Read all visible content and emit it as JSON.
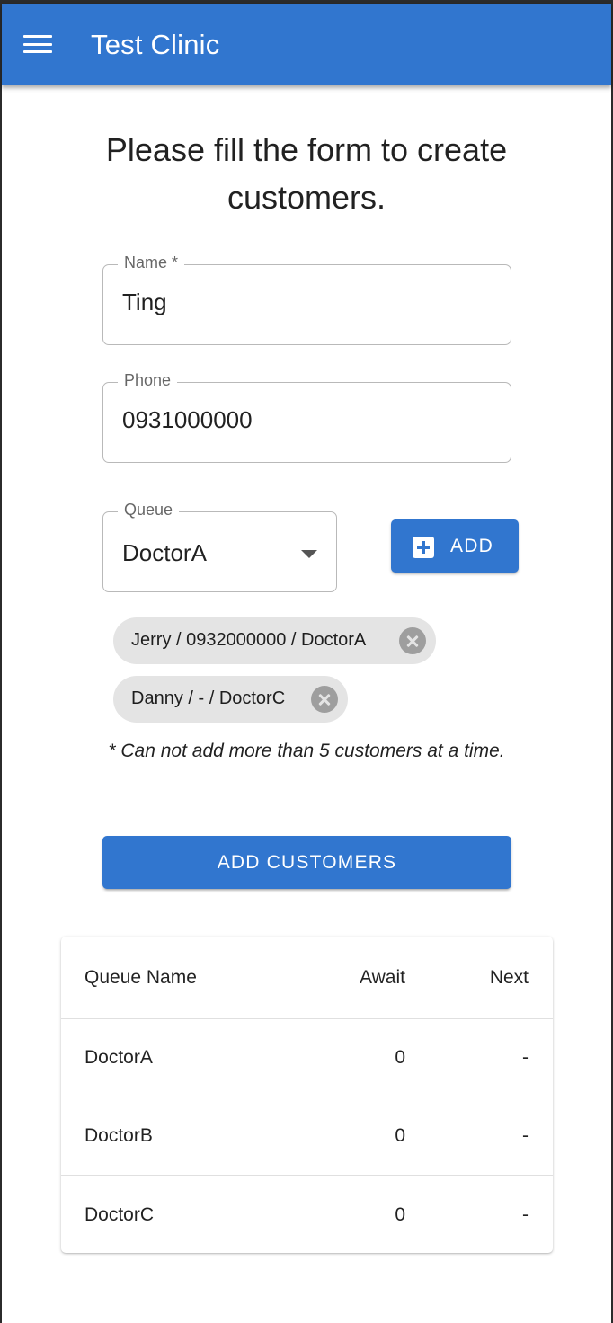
{
  "app_bar": {
    "title": "Test Clinic",
    "menu_icon": "hamburger-menu-icon",
    "color": "#3176cf"
  },
  "form": {
    "heading": "Please fill the form to create customers.",
    "name": {
      "label": "Name *",
      "value": "Ting"
    },
    "phone": {
      "label": "Phone",
      "value": "0931000000"
    },
    "queue": {
      "label": "Queue",
      "selected": "DoctorA"
    },
    "add_button": {
      "label": "ADD",
      "icon": "add-box-icon"
    },
    "customers": [
      {
        "label": "Jerry / 0932000000 / DoctorA"
      },
      {
        "label": "Danny / - / DoctorC"
      }
    ],
    "note": "* Can not add more than 5 customers at a time.",
    "submit_button": "ADD CUSTOMERS"
  },
  "queue_table": {
    "headers": [
      "Queue Name",
      "Await",
      "Next"
    ],
    "rows": [
      {
        "name": "DoctorA",
        "await": "0",
        "next": "-"
      },
      {
        "name": "DoctorB",
        "await": "0",
        "next": "-"
      },
      {
        "name": "DoctorC",
        "await": "0",
        "next": "-"
      }
    ]
  }
}
